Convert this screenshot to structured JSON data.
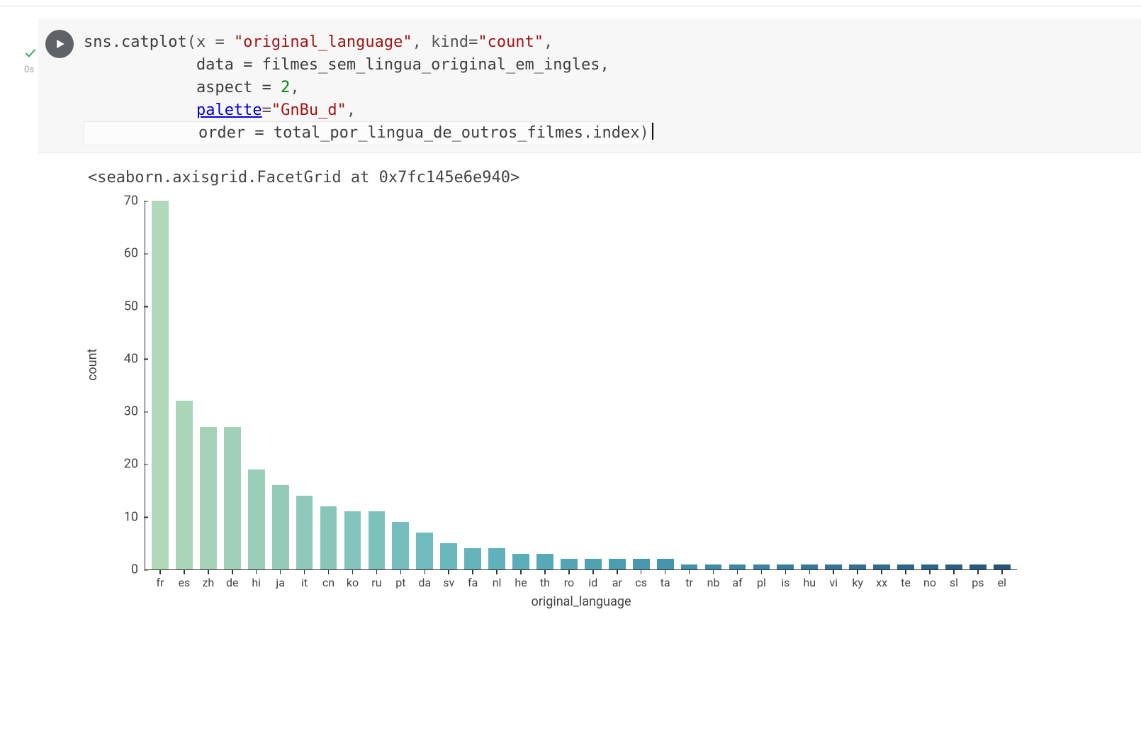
{
  "gutter": {
    "status_icon": "check",
    "exec_time": "0s"
  },
  "code": {
    "line1_a": "sns.catplot",
    "line1_p": "(x = ",
    "line1_str1": "\"original_language\"",
    "line1_mid": ", kind=",
    "line1_str2": "\"count\"",
    "line1_end": ",",
    "line2_a": "            data = filmes_sem_lingua_original_em_ingles,",
    "line3_a": "            aspect = ",
    "line3_num": "2",
    "line3_end": ",",
    "line4_a": "            ",
    "line4_kw": "palette",
    "line4_mid": "=",
    "line4_str": "\"GnBu_d\"",
    "line4_end": ",",
    "line5_a": "            order = total_por_lingua_de_outros_filmes.index",
    "line5_end": ")"
  },
  "output": {
    "repr": "<seaborn.axisgrid.FacetGrid at 0x7fc145e6e940>"
  },
  "chart_data": {
    "type": "bar",
    "xlabel": "original_language",
    "ylabel": "count",
    "ylim": [
      0,
      70
    ],
    "y_ticks": [
      0,
      10,
      20,
      30,
      40,
      50,
      60,
      70
    ],
    "palette": "GnBu_d",
    "categories": [
      "fr",
      "es",
      "zh",
      "de",
      "hi",
      "ja",
      "it",
      "cn",
      "ko",
      "ru",
      "pt",
      "da",
      "sv",
      "fa",
      "nl",
      "he",
      "th",
      "ro",
      "id",
      "ar",
      "cs",
      "ta",
      "tr",
      "nb",
      "af",
      "pl",
      "is",
      "hu",
      "vi",
      "ky",
      "xx",
      "te",
      "no",
      "sl",
      "ps",
      "el"
    ],
    "values": [
      70,
      32,
      27,
      27,
      19,
      16,
      14,
      12,
      11,
      11,
      9,
      7,
      5,
      4,
      4,
      3,
      3,
      2,
      2,
      2,
      2,
      2,
      1,
      1,
      1,
      1,
      1,
      1,
      1,
      1,
      1,
      1,
      1,
      1,
      1,
      1
    ],
    "colors": [
      "#b1d8b9",
      "#abd5b9",
      "#a6d3b8",
      "#a0d0b8",
      "#9aceb8",
      "#94cbb8",
      "#8ec9b9",
      "#88c6ba",
      "#82c3bb",
      "#7cc1bc",
      "#76bebd",
      "#70bbbd",
      "#6ab8bd",
      "#65b4bc",
      "#60b1bb",
      "#5badba",
      "#57a9b8",
      "#53a5b6",
      "#4fa1b4",
      "#4b9db2",
      "#4899b0",
      "#4595ae",
      "#4290ab",
      "#3f8ca8",
      "#3d87a5",
      "#3a83a2",
      "#387e9e",
      "#367a9b",
      "#347597",
      "#327093",
      "#306c90",
      "#2e678c",
      "#2c6388",
      "#2a5e84",
      "#285a80",
      "#26557c"
    ]
  }
}
